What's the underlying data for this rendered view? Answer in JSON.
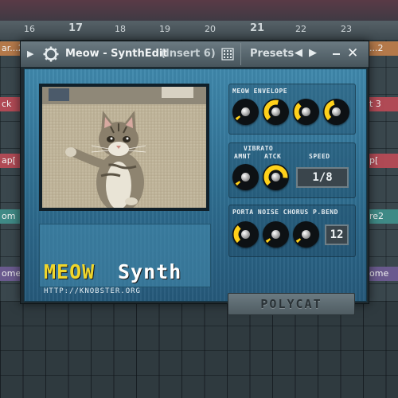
{
  "daw": {
    "ruler": [
      "16",
      "17",
      "18",
      "19",
      "20",
      "21",
      "22",
      "23"
    ],
    "clips": [
      {
        "label": "ar...2",
        "color": "#b4794a"
      },
      {
        "label": "...2",
        "color": "#b4794a"
      },
      {
        "label": "ck",
        "color": "#b04a55"
      },
      {
        "label": "t 3",
        "color": "#b04a55"
      },
      {
        "label": "ap[",
        "color": "#b04a55"
      },
      {
        "label": "p[",
        "color": "#b04a55"
      },
      {
        "label": "om",
        "color": "#3f8a86"
      },
      {
        "label": "re2",
        "color": "#3f8a86"
      },
      {
        "label": "ome",
        "color": "#6a5a8e"
      },
      {
        "label": "ome",
        "color": "#6a5a8e"
      }
    ]
  },
  "plugin": {
    "title": "Meow - SynthEdit",
    "subtitle": "(Insert 6)",
    "presets_label": "Presets",
    "prev_icon": "chevron-left-icon",
    "next_icon": "chevron-right-icon",
    "logo": {
      "meow": "MEOW",
      "synth": "Synth",
      "url": "HTTP://KNOBSTER.ORG"
    },
    "meow_envelope": {
      "title": "MEOW ENVELOPE",
      "knobs": [
        0.05,
        0.55,
        0.35,
        0.45
      ]
    },
    "vibrato": {
      "title": "VIBRATO",
      "amnt_label": "AMNT",
      "atck_label": "ATCK",
      "speed_label": "SPEED",
      "amnt": 0.05,
      "atck": 0.85,
      "speed_value": "1/8"
    },
    "porta_section": {
      "labels": "PORTA NOISE CHORUS P.BEND",
      "knobs": [
        0.35,
        0.05,
        0.05
      ],
      "bend_value": "12"
    },
    "polycat_label": "POLYCAT",
    "colors": {
      "knob_arc": "#ffd11a",
      "panel_blue": "#2f6f92",
      "logo_yellow": "#f0d62a"
    }
  }
}
